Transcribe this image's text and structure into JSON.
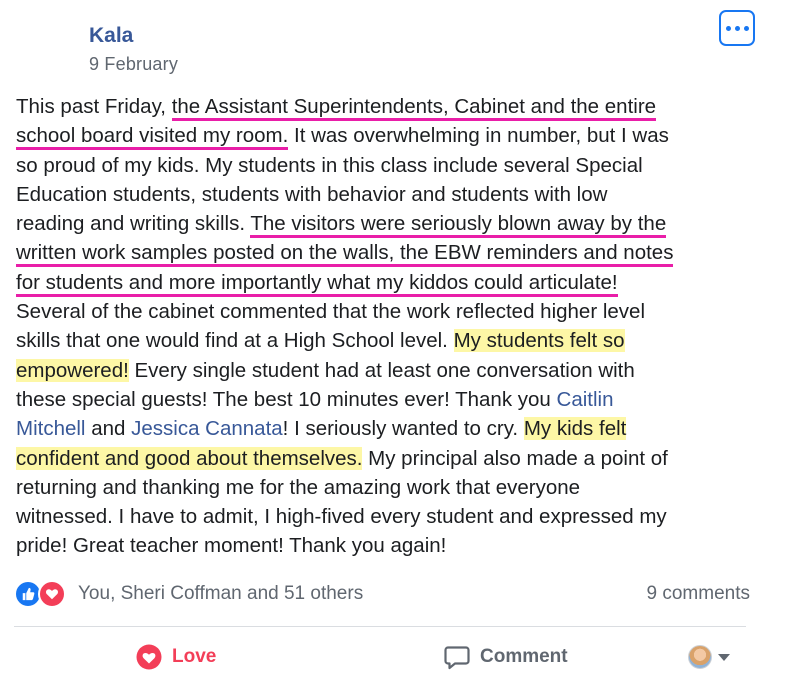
{
  "post": {
    "author": "Kala",
    "date": "9 February",
    "lines": [
      [
        "This past Friday, ",
        "the Assistant Superintendents, Cabinet and the entire"
      ],
      [
        "school board visited my room.",
        " It was overwhelming in number, but I was"
      ],
      [
        "so proud of my kids. My students in this class include several Special"
      ],
      [
        "Education students, students with behavior and students with low"
      ],
      [
        "reading and writing skills. ",
        "The visitors were seriously blown away by the"
      ],
      [
        "written work samples posted on the walls, the EBW reminders and notes"
      ],
      [
        "for students and more importantly what my kiddos could articulate!"
      ],
      [
        "Several of the cabinet commented that the work reflected higher level"
      ],
      [
        "skills that one would find at a High School level. ",
        "My students felt so"
      ],
      [
        "empowered!",
        " Every single student had at least one conversation with"
      ],
      [
        "these special guests! The best 10 minutes ever! Thank you ",
        "Caitlin"
      ],
      [
        "Mitchell",
        " and ",
        "Jessica Cannata",
        "! I seriously wanted to cry. ",
        "My kids felt"
      ],
      [
        "confident and good about themselves.",
        " My principal also made a point of"
      ],
      [
        "returning and thanking me for the amazing work that everyone"
      ],
      [
        "witnessed. I have to admit, I high-fived every student and expressed my"
      ],
      [
        "pride! Great teacher moment! Thank you again!"
      ]
    ]
  },
  "reactions": {
    "summary": "You, Sheri Coffman and 51 others",
    "comments": "9 comments"
  },
  "actions": {
    "love_label": "Love",
    "comment_label": "Comment"
  },
  "icons": {
    "more": "more-options-icon",
    "like": "like-reaction-icon",
    "love": "love-reaction-icon",
    "comment": "comment-icon"
  },
  "colors": {
    "accent": "#1877f2",
    "name_link": "#385898",
    "love": "#f33e58",
    "underline": "#e91ea8",
    "highlight": "#fdf7a6"
  }
}
